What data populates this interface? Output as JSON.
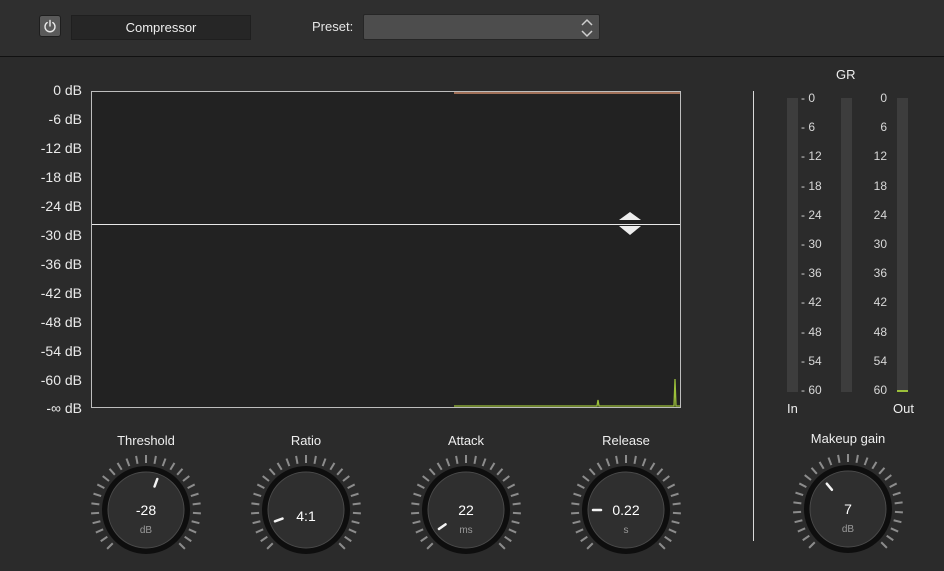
{
  "header": {
    "plugin_name": "Compressor",
    "preset_label": "Preset:",
    "preset_value": ""
  },
  "graph": {
    "db_labels": [
      "0 dB",
      "-6 dB",
      "-12 dB",
      "-18 dB",
      "-24 dB",
      "-30 dB",
      "-36 dB",
      "-42 dB",
      "-48 dB",
      "-54 dB",
      "-60 dB",
      "-∞ dB"
    ],
    "threshold_db": -28
  },
  "meters": {
    "title": "GR",
    "left_ticks": [
      "- 0",
      "- 6",
      "- 12",
      "- 18",
      "- 24",
      "- 30",
      "- 36",
      "- 42",
      "- 48",
      "- 54",
      "- 60"
    ],
    "right_ticks": [
      "0",
      "6",
      "12",
      "18",
      "24",
      "30",
      "36",
      "42",
      "48",
      "54",
      "60"
    ],
    "in_label": "In",
    "out_label": "Out"
  },
  "knobs": {
    "threshold": {
      "title": "Threshold",
      "value": "-28",
      "unit": "dB"
    },
    "ratio": {
      "title": "Ratio",
      "value": "4:1",
      "unit": ""
    },
    "attack": {
      "title": "Attack",
      "value": "22",
      "unit": "ms"
    },
    "release": {
      "title": "Release",
      "value": "0.22",
      "unit": "s"
    },
    "makeup": {
      "title": "Makeup gain",
      "value": "7",
      "unit": "dB"
    }
  },
  "colors": {
    "accent_green": "#9bbf3a",
    "accent_orange": "#c98a6a"
  }
}
